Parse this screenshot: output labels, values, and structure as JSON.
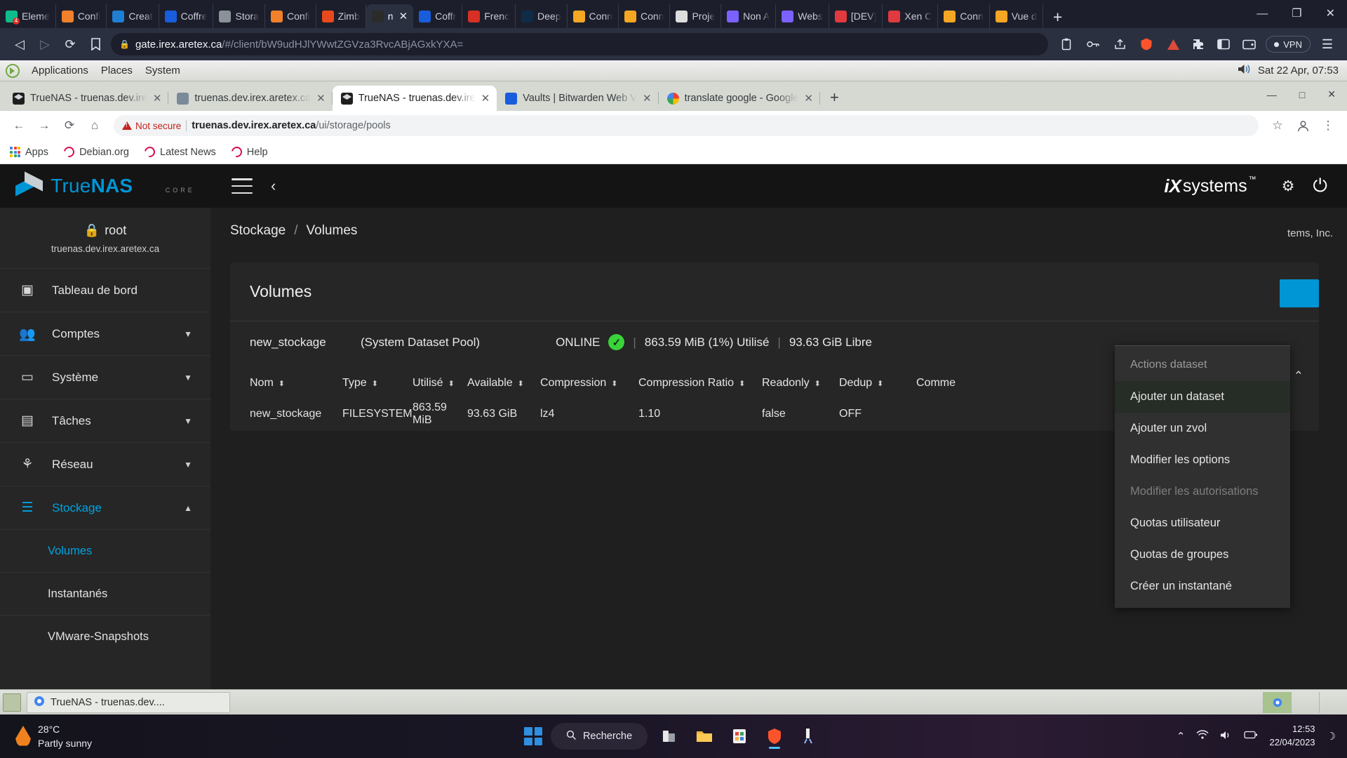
{
  "brave": {
    "tabs": [
      {
        "label": "Eleme",
        "icon": "element-icon",
        "color": "#0dbd8b",
        "badge": "4"
      },
      {
        "label": "Confi",
        "icon": "play-icon",
        "color": "#f0802a"
      },
      {
        "label": "Creat",
        "icon": "water-drop-icon",
        "color": "#1e7fd4"
      },
      {
        "label": "Coffre",
        "icon": "bitwarden-shield-icon",
        "color": "#175ddc"
      },
      {
        "label": "Stora",
        "icon": "storage-icon",
        "color": "#8b9199"
      },
      {
        "label": "Confi",
        "icon": "play-icon",
        "color": "#f0802a"
      },
      {
        "label": "Zimb",
        "icon": "zimbra-icon",
        "color": "#e8491d"
      },
      {
        "label": "n",
        "icon": "terminal-icon",
        "color": "#2b2b2b",
        "active": true
      },
      {
        "label": "Coffr",
        "icon": "bitwarden-shield-icon",
        "color": "#175ddc"
      },
      {
        "label": "Frenc",
        "icon": "french-icon",
        "color": "#d93025"
      },
      {
        "label": "Deep",
        "icon": "deepl-icon",
        "color": "#0f2b46"
      },
      {
        "label": "Conn",
        "icon": "flame-icon",
        "color": "#f5a623"
      },
      {
        "label": "Conn",
        "icon": "flame-icon",
        "color": "#f5a623"
      },
      {
        "label": "Proje",
        "icon": "people-icon",
        "color": "#dddddd"
      },
      {
        "label": "Non A",
        "icon": "headset-icon",
        "color": "#7b61ff"
      },
      {
        "label": "Webs",
        "icon": "headset-icon",
        "color": "#7b61ff"
      },
      {
        "label": "[DEV]",
        "icon": "xen-icon",
        "color": "#e03a3e"
      },
      {
        "label": "Xen C",
        "icon": "xen-icon",
        "color": "#e03a3e"
      },
      {
        "label": "Conn",
        "icon": "flame-icon",
        "color": "#f5a623"
      },
      {
        "label": "Vue d",
        "icon": "flame-icon",
        "color": "#f5a623"
      }
    ],
    "new_tab": "+",
    "close_glyph": "✕",
    "window_controls": [
      "—",
      "❐",
      "✕"
    ],
    "nav": {
      "back": "◁",
      "forward": "▷",
      "reload": "⟳",
      "bookmark": "🔖",
      "lock_icon": "lock-icon",
      "url_host": "gate.irex.aretex.ca",
      "url_path": "/#/client/bW9udHJlYWwtZGVza3RvcABjAGxkYXA=",
      "vpn_label": "VPN",
      "right_icons": [
        "puzzle-icon",
        "sidebar-icon",
        "wallet-icon"
      ],
      "brave_icon": "brave-lion-icon",
      "leo_icon": "leo-icon",
      "menu_icon": "hamburger-menu-icon"
    }
  },
  "mate_panel": {
    "menus": [
      "Applications",
      "Places",
      "System"
    ],
    "volume_icon": "volume-icon",
    "clock": "Sat 22 Apr, 07:53"
  },
  "chrome": {
    "tabs": [
      {
        "label": "TrueNAS - truenas.dev.ire",
        "icon": "truenas-icon",
        "active": false
      },
      {
        "label": "truenas.dev.irex.aretex.ca",
        "icon": "globe-icon",
        "active": false
      },
      {
        "label": "TrueNAS - truenas.dev.ire",
        "icon": "truenas-icon",
        "active": true
      },
      {
        "label": "Vaults | Bitwarden Web V",
        "icon": "bitwarden-shield-icon",
        "active": false
      },
      {
        "label": "translate google - Google",
        "icon": "google-icon",
        "active": false
      }
    ],
    "new_tab": "+",
    "close_glyph": "✕",
    "window_controls": [
      "—",
      "□",
      "✕"
    ],
    "nav": {
      "back": "←",
      "forward": "→",
      "reload": "⟳",
      "home": "⌂",
      "not_secure": "Not secure",
      "url_host": "truenas.dev.irex.aretex.ca",
      "url_path": "/ui/storage/pools",
      "star_icon": "star-icon",
      "profile_icon": "profile-avatar-icon",
      "menu_icon": "chrome-menu-icon"
    },
    "bookmarks": [
      {
        "label": "Apps",
        "icon": "apps-grid-icon"
      },
      {
        "label": "Debian.org",
        "icon": "debian-icon"
      },
      {
        "label": "Latest News",
        "icon": "debian-icon"
      },
      {
        "label": "Help",
        "icon": "debian-icon"
      }
    ]
  },
  "truenas": {
    "brand": {
      "name_light": "True",
      "name_bold": "NAS",
      "edition": "CORE"
    },
    "header": {
      "menu_icon": "hamburger-menu-icon",
      "back_icon": "chevron-left-icon",
      "vendor_ix": "iX",
      "vendor_systems": "systems",
      "vendor_tm": "™",
      "icons": [
        "power-icon"
      ],
      "power_icon": "power-icon"
    },
    "sidebar": {
      "user": "root",
      "host": "truenas.dev.irex.aretex.ca",
      "lock_icon": "lock-icon",
      "items": [
        {
          "label": "Tableau de bord",
          "icon": "dashboard-icon",
          "expandable": false,
          "active": false
        },
        {
          "label": "Comptes",
          "icon": "people-icon",
          "expandable": true,
          "active": false
        },
        {
          "label": "Système",
          "icon": "monitor-icon",
          "expandable": true,
          "active": false
        },
        {
          "label": "Tâches",
          "icon": "calendar-icon",
          "expandable": true,
          "active": false
        },
        {
          "label": "Réseau",
          "icon": "network-icon",
          "expandable": true,
          "active": false
        },
        {
          "label": "Stockage",
          "icon": "storage-list-icon",
          "expandable": true,
          "active": true,
          "expanded": true
        }
      ],
      "sub_items": [
        {
          "label": "Volumes",
          "active": true
        },
        {
          "label": "Instantanés",
          "active": false
        },
        {
          "label": "VMware-Snapshots",
          "active": false
        }
      ]
    },
    "breadcrumb": {
      "root": "Stockage",
      "sep": "/",
      "current": "Volumes"
    },
    "copyright": "tems, Inc.",
    "card": {
      "title": "Volumes",
      "pool_name": "new_stockage",
      "pool_role": "(System Dataset Pool)",
      "status": "ONLINE",
      "status_icon": "check-circle-icon",
      "used": "863.59 MiB (1%) Utilisé",
      "free": "93.63 GiB Libre",
      "collapse_icon": "chevron-up-icon"
    },
    "table": {
      "columns": [
        "Nom",
        "Type",
        "Utilisé",
        "Available",
        "Compression",
        "Compression Ratio",
        "Readonly",
        "Dedup",
        "Comme"
      ],
      "rows": [
        {
          "nom": "new_stockage",
          "type": "FILESYSTEM",
          "utilise": "863.59 MiB",
          "available": "93.63 GiB",
          "compression": "lz4",
          "ratio": "1.10",
          "readonly": "false",
          "dedup": "OFF",
          "comment": ""
        }
      ],
      "sort_icon": "sort-arrows-icon"
    },
    "menu": {
      "title": "Actions dataset",
      "items": [
        {
          "label": "Ajouter un dataset",
          "disabled": false,
          "highlighted": true
        },
        {
          "label": "Ajouter un zvol",
          "disabled": false,
          "highlighted": false
        },
        {
          "label": "Modifier les options",
          "disabled": false,
          "highlighted": false
        },
        {
          "label": "Modifier les autorisations",
          "disabled": true,
          "highlighted": false
        },
        {
          "label": "Quotas utilisateur",
          "disabled": false,
          "highlighted": false
        },
        {
          "label": "Quotas de groupes",
          "disabled": false,
          "highlighted": false
        },
        {
          "label": "Créer un instantané",
          "disabled": false,
          "highlighted": false
        }
      ]
    }
  },
  "window_list": {
    "show_desktop_icon": "show-desktop-icon",
    "buttons": [
      {
        "label": "TrueNAS - truenas.dev....",
        "icon": "chrome-icon"
      }
    ]
  },
  "win11_taskbar": {
    "weather": {
      "temp": "28°C",
      "condition": "Partly sunny",
      "icon": "partly-sunny-icon"
    },
    "start_icon": "windows-start-icon",
    "search": {
      "label": "Recherche",
      "icon": "search-icon"
    },
    "pinned": [
      {
        "icon": "file-explorer-icon",
        "active": false
      },
      {
        "icon": "folder-icon",
        "active": false
      },
      {
        "icon": "store-icon",
        "active": false
      },
      {
        "icon": "brave-icon",
        "active": true
      },
      {
        "icon": "snipping-tool-icon",
        "active": false
      }
    ],
    "tray_icons": [
      "chevron-up-icon",
      "wifi-icon",
      "volume-icon",
      "battery-icon"
    ],
    "clock_time": "12:53",
    "clock_date": "22/04/2023",
    "notification_icon": "moon-icon"
  }
}
